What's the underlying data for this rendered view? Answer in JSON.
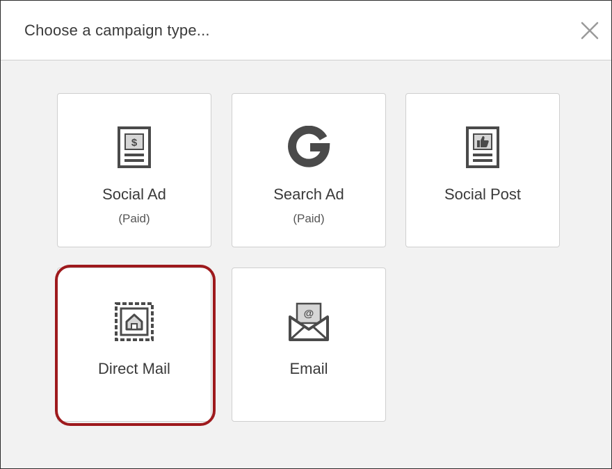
{
  "dialog": {
    "title": "Choose a campaign type...",
    "close_icon": "close-icon"
  },
  "cards": [
    {
      "label": "Social Ad",
      "sub": "(Paid)",
      "icon": "social-ad-icon"
    },
    {
      "label": "Search Ad",
      "sub": "(Paid)",
      "icon": "google-icon"
    },
    {
      "label": "Social Post",
      "sub": "",
      "icon": "social-post-icon"
    },
    {
      "label": "Direct Mail",
      "sub": "",
      "icon": "stamp-icon",
      "highlighted": true
    },
    {
      "label": "Email",
      "sub": "",
      "icon": "email-icon"
    }
  ],
  "colors": {
    "highlight": "#9e1a1d",
    "icon": "#4a4a4a",
    "background": "#f2f2f2"
  }
}
